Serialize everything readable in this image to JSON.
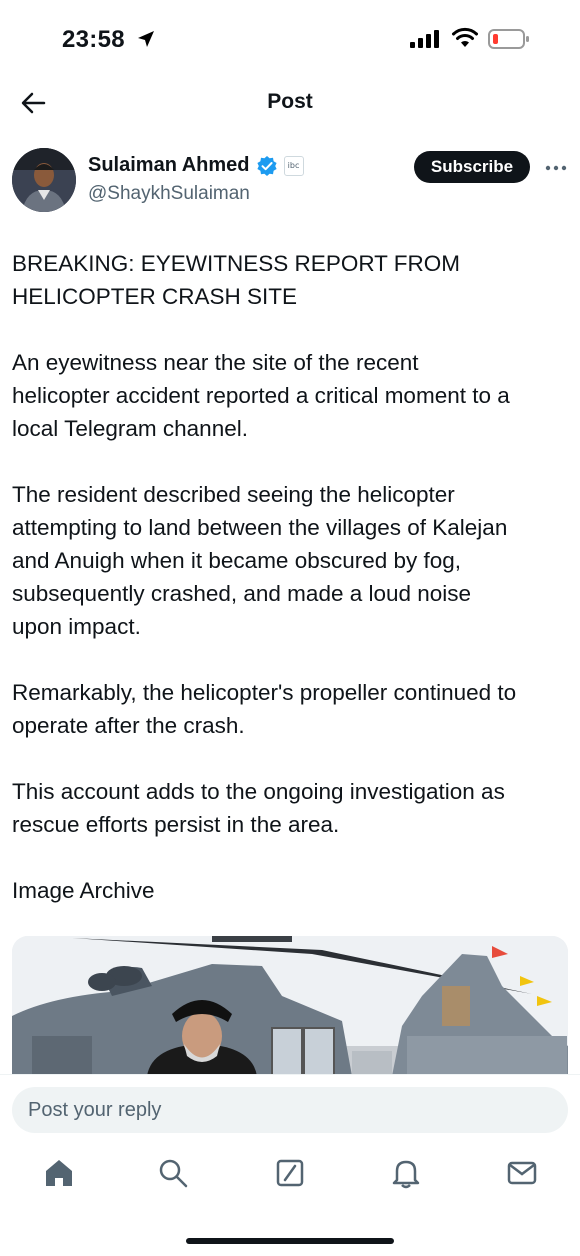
{
  "status_bar": {
    "time": "23:58",
    "battery_color": "#ff3b30"
  },
  "header": {
    "title": "Post"
  },
  "author": {
    "display_name": "Sulaiman Ahmed",
    "handle": "@ShaykhSulaiman",
    "verified_color": "#1d9bf0",
    "affiliate_label": "ibc",
    "subscribe_label": "Subscribe"
  },
  "post": {
    "paragraphs": [
      "BREAKING: EYEWITNESS REPORT FROM\nHELICOPTER CRASH SITE",
      "An eyewitness near the site of the recent\nhelicopter accident reported a critical moment to a\nlocal Telegram channel.",
      "The resident described seeing the helicopter\nattempting to land between the villages of Kalejan\nand Anuigh when it became obscured by fog,\nsubsequently crashed, and made a loud noise\nupon impact.",
      "Remarkably, the helicopter's propeller continued to\noperate after the crash.",
      "This account adds to the ongoing investigation as\nrescue efforts persist in the area.",
      "Image Archive"
    ]
  },
  "reply": {
    "placeholder": "Post your reply"
  },
  "nav": {
    "items": [
      "home-icon",
      "search-icon",
      "grok-icon",
      "notifications-icon",
      "messages-icon"
    ]
  }
}
